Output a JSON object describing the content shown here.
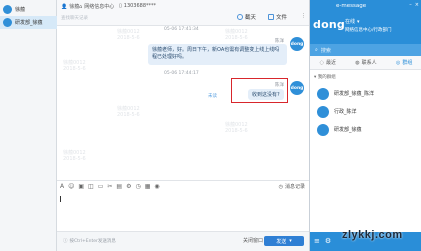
{
  "left_list": {
    "items": [
      {
        "label": "徐蕴",
        "selected": false
      },
      {
        "label": "研发部_徐蕴",
        "selected": true
      }
    ]
  },
  "chat": {
    "header": {
      "contact": "徐蕴",
      "department": "网络信息中心",
      "phone": "1303688****",
      "search_hint": "查找聊天记录",
      "screenshot_label": "截天",
      "file_label": "文件"
    },
    "messages": [
      {
        "time": "05-06 17:41:34",
        "sender": "陈洋",
        "avatar": "dong",
        "text": "徐蕴老师，好。周日下午，新OA也需有调整变上线上线吗程已处理好吗。"
      },
      {
        "time": "05-06 17:44:17",
        "sender": "陈洋",
        "avatar": "dong",
        "text": "收到这没有?",
        "read_status": "未读"
      }
    ],
    "watermark": "徐蕴0012\n2018-5-6",
    "toolbar": {
      "message_log_label": "消息记录"
    },
    "footer": {
      "hint": "按Ctrl+Enter发送消息",
      "close_label": "关闭窗口",
      "send_label": "发送"
    }
  },
  "panel": {
    "title": "e-message",
    "user_avatar": "dong",
    "status": "在线",
    "org": "网络信息中心/行政部门",
    "search_placeholder": "搜索",
    "tabs": [
      {
        "label": "最近",
        "selected": false
      },
      {
        "label": "联系人",
        "selected": false
      },
      {
        "label": "群组",
        "selected": true
      }
    ],
    "section_title": "我的群组",
    "groups": [
      {
        "label": "研发部_徐蕴_陈洋"
      },
      {
        "label": "行政_陈洋"
      },
      {
        "label": "研发部_徐蕴"
      }
    ]
  },
  "site_mark": "zlykkj.com",
  "colors": {
    "accent": "#2a8ed8",
    "highlight_border": "#d8262c",
    "bubble": "#e4eef9"
  }
}
